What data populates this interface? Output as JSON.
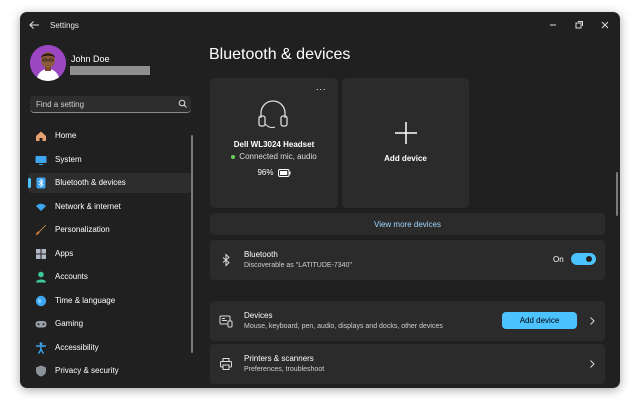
{
  "window": {
    "title": "Settings"
  },
  "user": {
    "name": "John Doe"
  },
  "search": {
    "placeholder": "Find a setting"
  },
  "nav": {
    "items": [
      {
        "label": "Home",
        "icon": "home-icon",
        "active": false
      },
      {
        "label": "System",
        "icon": "system-icon",
        "active": false
      },
      {
        "label": "Bluetooth & devices",
        "icon": "bluetooth-icon",
        "active": true
      },
      {
        "label": "Network & internet",
        "icon": "wifi-icon",
        "active": false
      },
      {
        "label": "Personalization",
        "icon": "brush-icon",
        "active": false
      },
      {
        "label": "Apps",
        "icon": "apps-icon",
        "active": false
      },
      {
        "label": "Accounts",
        "icon": "accounts-icon",
        "active": false
      },
      {
        "label": "Time & language",
        "icon": "globe-icon",
        "active": false
      },
      {
        "label": "Gaming",
        "icon": "gamepad-icon",
        "active": false
      },
      {
        "label": "Accessibility",
        "icon": "accessibility-icon",
        "active": false
      },
      {
        "label": "Privacy & security",
        "icon": "shield-icon",
        "active": false
      }
    ]
  },
  "main": {
    "title": "Bluetooth & devices",
    "device_card": {
      "more": "...",
      "name": "Dell WL3024 Headset",
      "status": "Connected mic, audio",
      "battery": "96%",
      "battery_level": 0.96
    },
    "add_card": {
      "label": "Add device"
    },
    "view_more": "View more devices",
    "bluetooth": {
      "title": "Bluetooth",
      "subtitle": "Discoverable as \"LATITUDE-7340\"",
      "state_label": "On",
      "enabled": true
    },
    "devices": {
      "title": "Devices",
      "subtitle": "Mouse, keyboard, pen, audio, displays and docks, other devices",
      "button": "Add device"
    },
    "printers": {
      "title": "Printers & scanners",
      "subtitle": "Preferences, troubleshoot"
    }
  },
  "colors": {
    "accent": "#4cc2ff",
    "background": "#202020",
    "card": "#2b2b2b",
    "status_green": "#6ccb5f"
  }
}
